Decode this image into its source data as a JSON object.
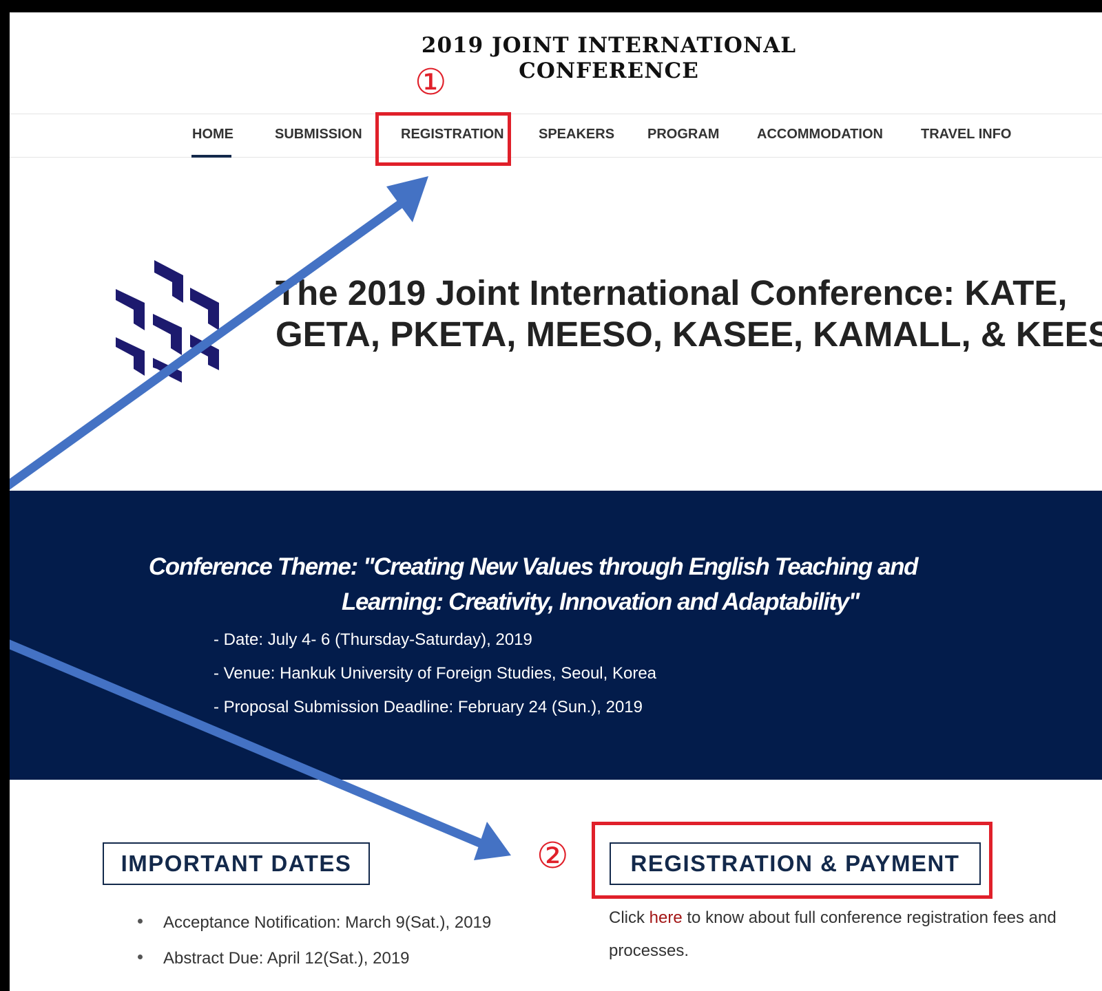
{
  "header": {
    "title_line1": "2019 JOINT INTERNATIONAL",
    "title_line2": "CONFERENCE"
  },
  "nav": {
    "items": [
      {
        "label": "HOME"
      },
      {
        "label": "SUBMISSION"
      },
      {
        "label": "REGISTRATION"
      },
      {
        "label": "SPEAKERS"
      },
      {
        "label": "PROGRAM"
      },
      {
        "label": "ACCOMMODATION"
      },
      {
        "label": "TRAVEL INFO"
      }
    ],
    "active": "HOME"
  },
  "annotations": {
    "marker1": "①",
    "marker2": "②",
    "highlight_color": "#e0202a",
    "arrow_color": "#4472c4"
  },
  "hero": {
    "title_line1": "The 2019 Joint International Conference: KATE,",
    "title_line2": "GETA, PKETA, MEESO, KASEE, KAMALL, & KEES",
    "logo": "hexagon-arrows-logo",
    "logo_color": "#1d1a6e"
  },
  "banner": {
    "theme_line1": "Conference Theme:  \"Creating New Values through English Teaching and",
    "theme_line2": "Learning: Creativity, Innovation and Adaptability\"",
    "date": "- Date: July 4- 6 (Thursday-Saturday), 2019",
    "venue": "- Venue: Hankuk University of Foreign Studies, Seoul, Korea",
    "deadline": "- Proposal Submission Deadline: February 24 (Sun.), 2019",
    "background": "#031c4b"
  },
  "important_dates": {
    "heading": "IMPORTANT DATES",
    "items": [
      "Acceptance Notification: March 9(Sat.), 2019",
      "Abstract Due: April 12(Sat.), 2019"
    ]
  },
  "registration": {
    "heading": "REGISTRATION & PAYMENT",
    "text_before": "Click ",
    "link": "here",
    "text_after": " to know about full conference registration fees and",
    "text_line2": "processes."
  }
}
